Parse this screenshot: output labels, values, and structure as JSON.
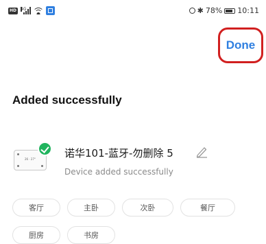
{
  "status_bar": {
    "hd_label": "HD",
    "signal_label": "4G",
    "battery_percent": "78%",
    "battery_level": 0.78,
    "time": "10:11"
  },
  "header": {
    "done_label": "Done"
  },
  "page": {
    "title": "Added successfully"
  },
  "device": {
    "name": "诺华101-蓝牙-勿删除 5",
    "status": "Device added successfully",
    "thumb_label": "26 · 27°"
  },
  "rooms": [
    "客厅",
    "主卧",
    "次卧",
    "餐厅",
    "厨房",
    "书房"
  ],
  "colors": {
    "accent": "#2f7fe0",
    "highlight": "#d11f1f",
    "success": "#20b45e"
  }
}
